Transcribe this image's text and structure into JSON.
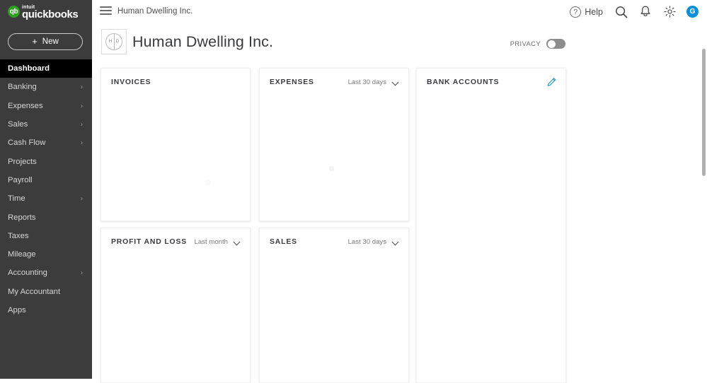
{
  "brand": {
    "logo_mark": "qb",
    "intuit_label": "intuit",
    "product_label": "quickbooks",
    "new_button_label": "New",
    "new_button_icon": "plus-icon"
  },
  "sidebar": {
    "items": [
      {
        "label": "Dashboard",
        "active": true,
        "has_chevron": false
      },
      {
        "label": "Banking",
        "active": false,
        "has_chevron": true
      },
      {
        "label": "Expenses",
        "active": false,
        "has_chevron": true
      },
      {
        "label": "Sales",
        "active": false,
        "has_chevron": true
      },
      {
        "label": "Cash Flow",
        "active": false,
        "has_chevron": true
      },
      {
        "label": "Projects",
        "active": false,
        "has_chevron": false
      },
      {
        "label": "Payroll",
        "active": false,
        "has_chevron": false
      },
      {
        "label": "Time",
        "active": false,
        "has_chevron": true
      },
      {
        "label": "Reports",
        "active": false,
        "has_chevron": false
      },
      {
        "label": "Taxes",
        "active": false,
        "has_chevron": false
      },
      {
        "label": "Mileage",
        "active": false,
        "has_chevron": false
      },
      {
        "label": "Accounting",
        "active": false,
        "has_chevron": true
      },
      {
        "label": "My Accountant",
        "active": false,
        "has_chevron": false
      },
      {
        "label": "Apps",
        "active": false,
        "has_chevron": false
      }
    ],
    "chevron_icon": "chevron-right-icon",
    "background_color": "#3c3c3c",
    "active_background_color": "#000000"
  },
  "topbar": {
    "menu_icon": "hamburger-menu-icon",
    "company_name": "Human Dwelling Inc.",
    "help_label": "Help",
    "help_icon": "question-circle-icon",
    "search_icon": "search-icon",
    "notifications_icon": "bell-icon",
    "settings_icon": "gear-icon",
    "avatar_initial": "G",
    "avatar_color": "#0a8fdb"
  },
  "page_header": {
    "logo_left_initial": "H",
    "logo_right_initial": "D",
    "title": "Human Dwelling Inc.",
    "privacy_label": "PRIVACY",
    "privacy_enabled": false
  },
  "cards": [
    {
      "id": "invoices",
      "title": "INVOICES",
      "range_label": null,
      "action_icon": null,
      "state": "loading"
    },
    {
      "id": "expenses",
      "title": "EXPENSES",
      "range_label": "Last 30 days",
      "range_icon": "chevron-down-icon",
      "action_icon": null,
      "state": "loading"
    },
    {
      "id": "bank-accounts",
      "title": "BANK ACCOUNTS",
      "range_label": null,
      "action_icon": "pencil-edit-icon",
      "action_icon_color": "#2196c4",
      "state": "loading"
    },
    {
      "id": "profit-and-loss",
      "title": "PROFIT AND LOSS",
      "range_label": "Last month",
      "range_icon": "chevron-down-icon",
      "action_icon": null,
      "state": "loading"
    },
    {
      "id": "sales",
      "title": "SALES",
      "range_label": "Last 30 days",
      "range_icon": "chevron-down-icon",
      "action_icon": null,
      "state": "loading"
    }
  ]
}
